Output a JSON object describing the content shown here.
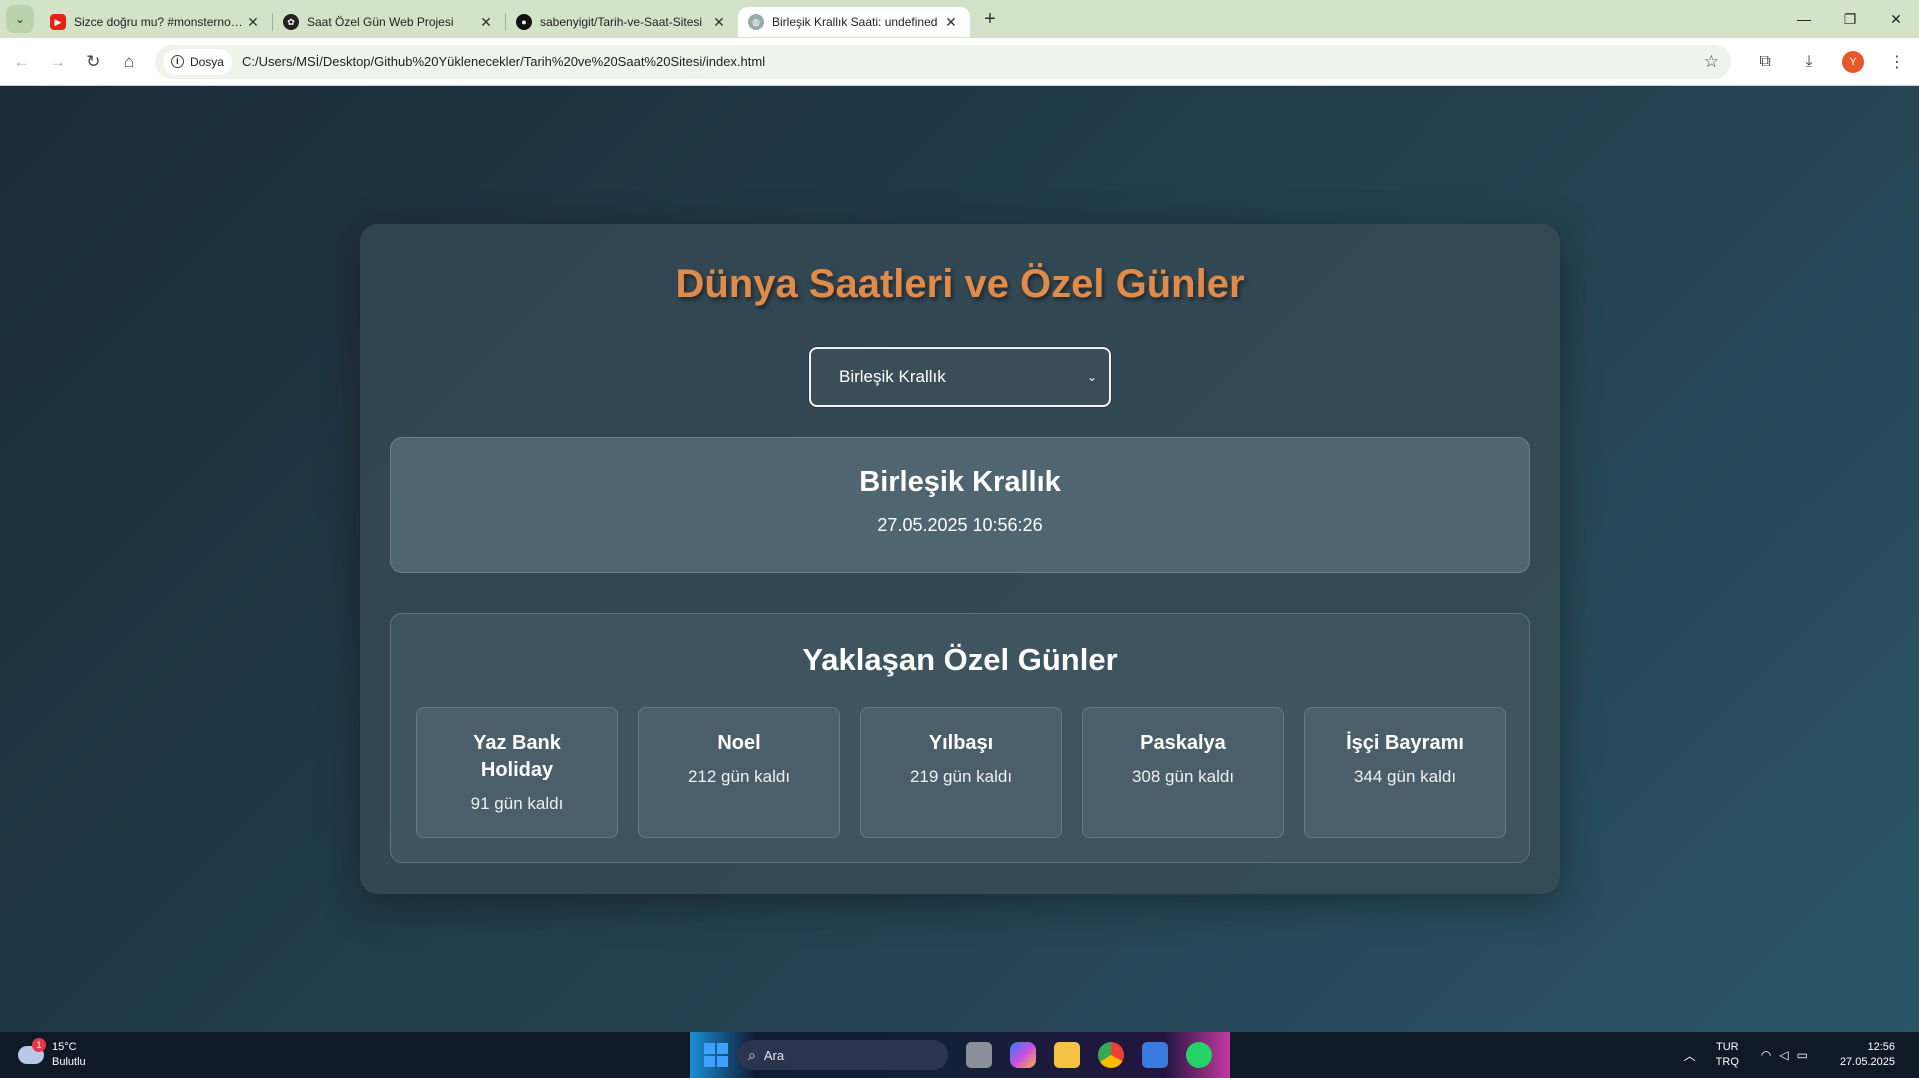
{
  "browser": {
    "tabs": [
      {
        "title": "Sizce doğru mu? #monsternotebook",
        "favicon": "youtube-icon",
        "active": false
      },
      {
        "title": "Saat Özel Gün Web Projesi",
        "favicon": "openai-icon",
        "active": false
      },
      {
        "title": "sabenyigit/Tarih-ve-Saat-Sitesi",
        "favicon": "github-icon",
        "active": false
      },
      {
        "title": "Birleşik Krallık Saati: undefined",
        "favicon": "globe-icon",
        "active": true
      }
    ],
    "new_tab": "+",
    "site_chip": "Dosya",
    "url": "C:/Users/MSİ/Desktop/Github%20Yüklenecekler/Tarih%20ve%20Saat%20Sitesi/index.html",
    "profile_initial": "Y"
  },
  "page": {
    "title": "Dünya Saatleri ve Özel Günler",
    "selected_country": "Birleşik Krallık",
    "clock": {
      "country": "Birleşik Krallık",
      "datetime": "27.05.2025 10:56:26"
    },
    "holidays": {
      "title": "Yaklaşan Özel Günler",
      "items": [
        {
          "name": "Yaz Bank Holiday",
          "days": "91 gün kaldı"
        },
        {
          "name": "Noel",
          "days": "212 gün kaldı"
        },
        {
          "name": "Yılbaşı",
          "days": "219 gün kaldı"
        },
        {
          "name": "Paskalya",
          "days": "308 gün kaldı"
        },
        {
          "name": "İşçi Bayramı",
          "days": "344 gün kaldı"
        }
      ]
    }
  },
  "taskbar": {
    "weather_temp": "15°C",
    "weather_desc": "Bulutlu",
    "weather_badge": "1",
    "search_placeholder": "Ara",
    "lang_top": "TUR",
    "lang_bottom": "TRQ",
    "time": "12:56",
    "date": "27.05.2025"
  },
  "colors": {
    "title_accent": "#e08b4a",
    "card_bg": "#374b56",
    "tabbar_bg": "#d3e3c8"
  }
}
